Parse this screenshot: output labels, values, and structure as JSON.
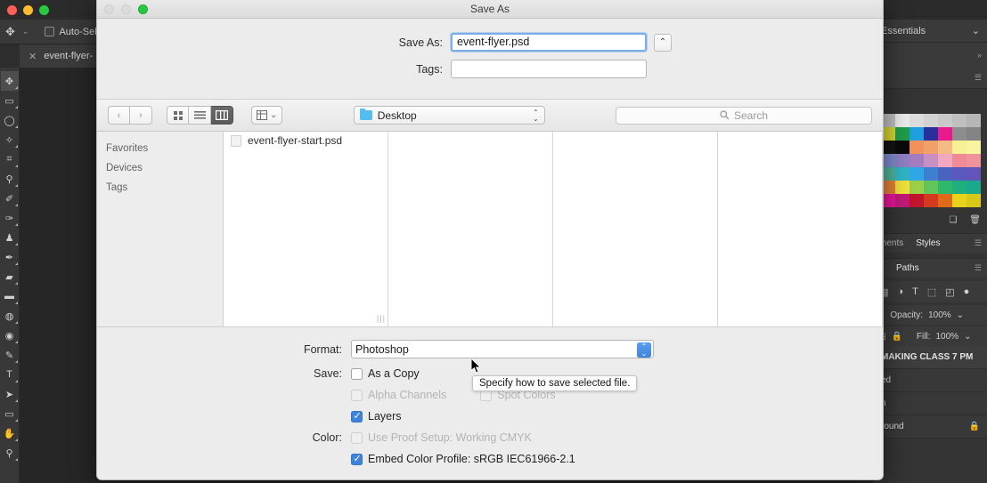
{
  "photoshop": {
    "window_traffic_lights": [
      "close",
      "minimize",
      "zoom"
    ],
    "options_bar": {
      "tool_icon": "move-tool-icon",
      "auto_select_label": "Auto-Selec"
    },
    "document_tab": {
      "label": "event-flyer-",
      "close_glyph": "✕"
    },
    "tools": [
      {
        "name": "move-tool",
        "glyph": "✥",
        "selected": true
      },
      {
        "name": "marquee-tool",
        "glyph": "▭",
        "selected": false
      },
      {
        "name": "lasso-tool",
        "glyph": "◯",
        "selected": false
      },
      {
        "name": "magic-wand-tool",
        "glyph": "✎",
        "selected": false
      },
      {
        "name": "crop-tool",
        "glyph": "⌗",
        "selected": false
      },
      {
        "name": "eyedropper-tool",
        "glyph": "⚲",
        "selected": false
      },
      {
        "name": "healing-brush-tool",
        "glyph": "✐",
        "selected": false
      },
      {
        "name": "brush-tool",
        "glyph": "✑",
        "selected": false
      },
      {
        "name": "clone-stamp-tool",
        "glyph": "♜",
        "selected": false
      },
      {
        "name": "history-brush-tool",
        "glyph": "✒",
        "selected": false
      },
      {
        "name": "eraser-tool",
        "glyph": "▰",
        "selected": false
      },
      {
        "name": "gradient-tool",
        "glyph": "◧",
        "selected": false
      },
      {
        "name": "blur-tool",
        "glyph": "💧",
        "selected": false
      },
      {
        "name": "dodge-tool",
        "glyph": "◉",
        "selected": false
      },
      {
        "name": "pen-tool",
        "glyph": "✎",
        "selected": false
      },
      {
        "name": "type-tool",
        "glyph": "T",
        "selected": false
      },
      {
        "name": "path-selection-tool",
        "glyph": "➤",
        "selected": false
      },
      {
        "name": "rectangle-tool",
        "glyph": "▭",
        "selected": false
      },
      {
        "name": "hand-tool",
        "glyph": "✋",
        "selected": false
      },
      {
        "name": "zoom-tool",
        "glyph": "🔍",
        "selected": false
      }
    ],
    "dock": {
      "workspace": "Essentials",
      "swatch_colors": [
        "#c0c0c0",
        "#e9e9e9",
        "#dcdcdc",
        "#d2d2d2",
        "#c9c9c9",
        "#bfbfbf",
        "#b6b6b6",
        "#d8d830",
        "#1f9c4a",
        "#1e9fe0",
        "#2b2f9e",
        "#e81a8c",
        "#8d8d8d",
        "#848484",
        "#141414",
        "#0a0a0a",
        "#f2915a",
        "#f2a06a",
        "#f5bb84",
        "#f8f094",
        "#f9f4a0",
        "#7d8ccd",
        "#8e7fc4",
        "#a57cc0",
        "#c98fc4",
        "#efa8c0",
        "#f28a96",
        "#f0939c",
        "#4fb59a",
        "#2fb5c4",
        "#2ea6e8",
        "#3d7fd0",
        "#4a63c0",
        "#5a58bc",
        "#6254b8",
        "#e8833a",
        "#f2e03c",
        "#9bcf48",
        "#63c45a",
        "#2fb86c",
        "#1fae7c",
        "#1aa98c",
        "#e8169c",
        "#c21a7a",
        "#c0152a",
        "#d43a1e",
        "#e06a1a",
        "#e8d21a",
        "#d8c818"
      ],
      "swatch_tools": [
        "new-swatch-icon",
        "delete-swatch-icon"
      ],
      "panel_tabs_top": [
        "ments",
        "Styles"
      ],
      "panel_tabs_mid": [
        "s",
        "Paths"
      ],
      "layer_filter_icons": [
        "pixel-filter-icon",
        "adjustment-filter-icon",
        "type-filter-icon",
        "shape-filter-icon",
        "smart-object-filter-icon",
        "toggle-filter-icon"
      ],
      "opacity_label": "Opacity:",
      "opacity_value": "100%",
      "fill_label": "Fill:",
      "fill_value": "100%",
      "layers": [
        {
          "name": "MAKING CLASS 7 PM",
          "bold": true,
          "locked": false
        },
        {
          "name": "ed",
          "bold": false,
          "locked": false
        },
        {
          "name": "n",
          "bold": false,
          "locked": false
        },
        {
          "name": "round",
          "bold": false,
          "locked": true
        }
      ]
    }
  },
  "dialog": {
    "title": "Save As",
    "save_as_label": "Save As:",
    "save_as_value": "event-flyer.psd",
    "tags_label": "Tags:",
    "tags_value": "",
    "disclosure_glyph": "⌃",
    "toolbar": {
      "back_glyph": "‹",
      "forward_glyph": "›",
      "view_icon_label": "icon-view-icon",
      "view_list_label": "list-view-icon",
      "view_column_label": "column-view-icon",
      "arrange_label": "arrange-by-icon",
      "arrange_chevron": "⌄",
      "path_label": "Desktop",
      "search_placeholder": "Search",
      "search_icon": "search-icon"
    },
    "sidebar": [
      {
        "label": "Favorites"
      },
      {
        "label": "Devices"
      },
      {
        "label": "Tags"
      }
    ],
    "files": [
      {
        "name": "event-flyer-start.psd"
      }
    ],
    "options": {
      "format_label": "Format:",
      "format_value": "Photoshop",
      "save_label": "Save:",
      "color_label": "Color:",
      "checkboxes": [
        {
          "id": "as-a-copy",
          "label": "As a Copy",
          "checked": false,
          "disabled": false
        },
        {
          "id": "alpha-channels",
          "label": "Alpha Channels",
          "checked": false,
          "disabled": true
        },
        {
          "id": "spot-colors",
          "label": "Spot Colors",
          "checked": false,
          "disabled": true
        },
        {
          "id": "layers",
          "label": "Layers",
          "checked": true,
          "disabled": false
        },
        {
          "id": "use-proof-setup",
          "label": "Use Proof Setup:  Working CMYK",
          "checked": false,
          "disabled": true
        },
        {
          "id": "embed-color-profile",
          "label": "Embed Color Profile:  sRGB IEC61966-2.1",
          "checked": true,
          "disabled": false
        }
      ],
      "tooltip": "Specify how to save selected file."
    }
  },
  "colors": {
    "accent": "#3f82dc",
    "dialog_bg": "#ececec",
    "folder_blue": "#56bdf0"
  }
}
